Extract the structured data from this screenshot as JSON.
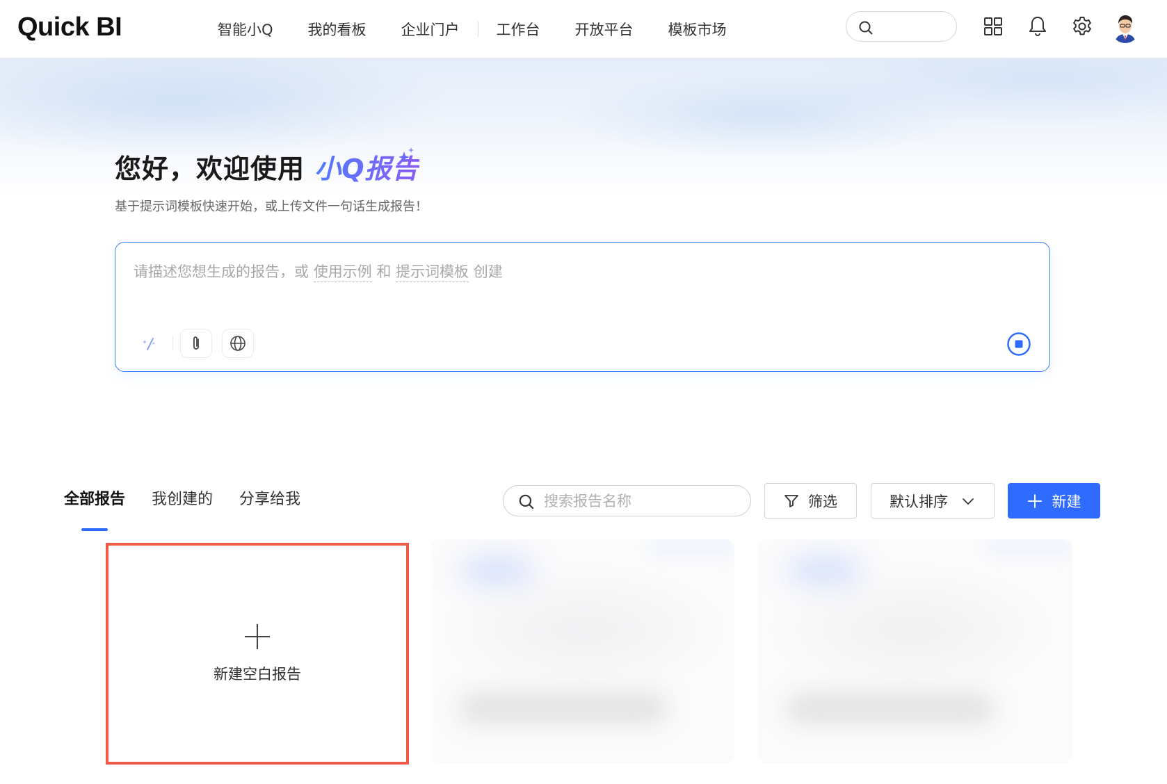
{
  "brand": {
    "logo_text": "Quick BI"
  },
  "nav": {
    "items": [
      "智能小Q",
      "我的看板",
      "企业门户",
      "工作台",
      "开放平台",
      "模板市场"
    ]
  },
  "icons": {
    "search": "search-icon",
    "apps": "grid-apps-icon",
    "notifications": "bell-icon",
    "settings": "gear-icon",
    "magic": "magic-wand-icon",
    "attach": "paperclip-icon",
    "web": "globe-icon",
    "send": "stop-circle-icon",
    "filter": "funnel-icon",
    "sort": "chevron-down-icon",
    "add": "plus-icon"
  },
  "hero": {
    "title_prefix": "您好，欢迎使用 ",
    "title_accent": "小Q报告",
    "subtitle": "基于提示词模板快速开始，或上传文件一句话生成报告！"
  },
  "prompt": {
    "part1": "请描述您想生成的报告，或 ",
    "link1": "使用示例",
    "part2": " 和 ",
    "link2": "提示词模板",
    "part3": " 创建"
  },
  "tabs": [
    "全部报告",
    "我创建的",
    "分享给我"
  ],
  "list": {
    "search_placeholder": "搜索报告名称",
    "filter_label": "筛选",
    "sort_label": "默认排序",
    "new_label": "新建"
  },
  "cards": {
    "new_blank_label": "新建空白报告"
  },
  "colors": {
    "primary": "#2f6bff",
    "highlight_border": "#f05a4a",
    "accent_gradient_start": "#4f7cff",
    "accent_gradient_end": "#8a5cf6"
  }
}
